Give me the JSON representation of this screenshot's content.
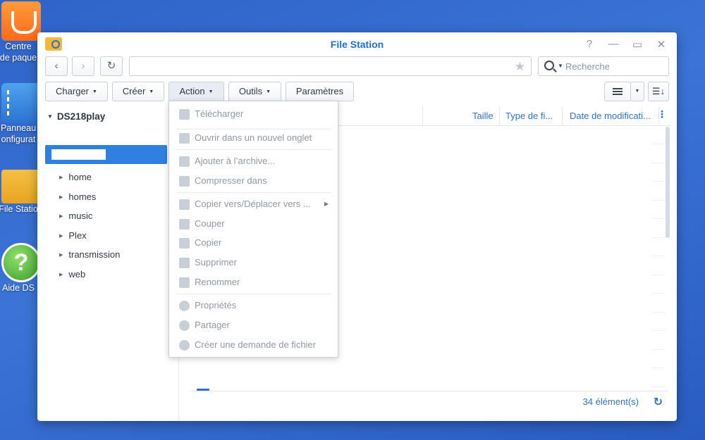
{
  "desktop": {
    "icons": [
      {
        "label_line1": "Centre",
        "label_line2": "de paque"
      },
      {
        "label_line1": "Panneau",
        "label_line2": "onfigurat"
      },
      {
        "label_line1": "File Statio"
      },
      {
        "label_line1": "Aide DS"
      }
    ]
  },
  "window": {
    "title": "File Station",
    "controls": {
      "help": "?",
      "minimize": "—",
      "maximize": "▭",
      "close": "✕"
    }
  },
  "toolbar": {
    "search_placeholder": "Recherche",
    "path_value": "",
    "charger": "Charger",
    "creer": "Créer",
    "action": "Action",
    "outils": "Outils",
    "parametres": "Paramètres"
  },
  "sidebar": {
    "root": "DS218play",
    "items": [
      "home",
      "homes",
      "music",
      "Plex",
      "transmission",
      "web"
    ]
  },
  "columns": {
    "taille": "Taille",
    "type": "Type de fi...",
    "date": "Date de modificati..."
  },
  "footer": {
    "count": "34 élément(s)"
  },
  "action_menu": {
    "items": [
      "Télécharger",
      "Ouvrir dans un nouvel onglet",
      "Ajouter à l’archive...",
      "Compresser dans",
      "Copier vers/Déplacer vers ...",
      "Couper",
      "Copier",
      "Supprimer",
      "Renommer",
      "Propriétés",
      "Partager",
      "Créer une demande de fichier"
    ]
  },
  "colors": {
    "accent": "#2f72c9",
    "selection": "#2f80e0",
    "title": "#1f6fd0",
    "disabled_text": "#8f99a5"
  }
}
